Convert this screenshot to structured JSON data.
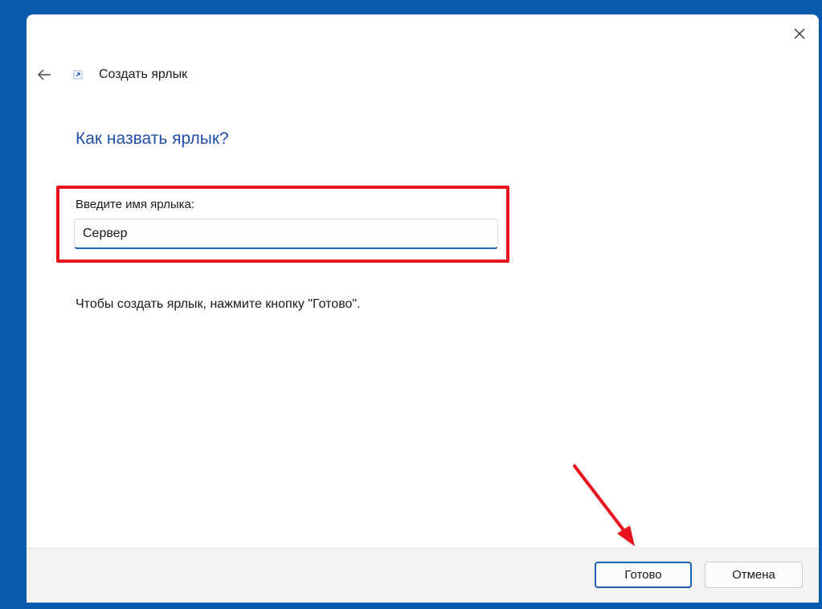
{
  "wizard": {
    "title": "Создать ярлык",
    "question": "Как назвать ярлык?",
    "name_label": "Введите имя ярлыка:",
    "name_value": "Сервер",
    "instruction": "Чтобы создать ярлык, нажмите кнопку \"Готово\"."
  },
  "footer": {
    "finish_label": "Готово",
    "cancel_label": "Отмена"
  },
  "icons": {
    "close": "close-icon",
    "back": "back-arrow-icon",
    "shortcut": "shortcut-icon"
  },
  "colors": {
    "accent": "#1f4fa8",
    "highlight": "#e8131d",
    "desktop": "#0a5bb0"
  }
}
